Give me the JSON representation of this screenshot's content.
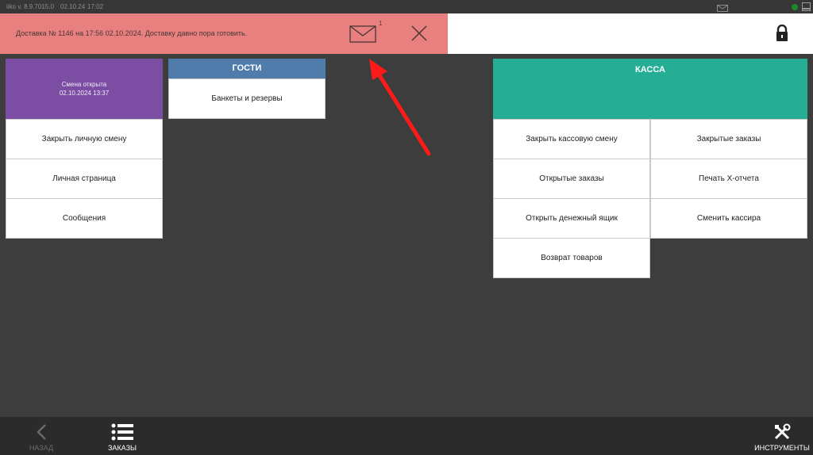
{
  "status_bar": {
    "version": "iiko  v. 8.9.7015.0",
    "date": "02.10.24",
    "time": "17:02"
  },
  "notification": {
    "text": "Доставка № 1146 на 17:56 02.10.2024. Доставку давно пора готовить.",
    "unread_count": "1"
  },
  "shift": {
    "status": "Смена открыта",
    "datetime": "02.10.2024 13:37"
  },
  "personal_menu": {
    "close_shift": "Закрыть личную смену",
    "personal_page": "Личная страница",
    "messages": "Сообщения"
  },
  "guests": {
    "header": "ГОСТИ",
    "banquets": "Банкеты и резервы"
  },
  "kassa": {
    "header": "КАССА",
    "close_cash_shift": "Закрыть кассовую смену",
    "closed_orders": "Закрытые заказы",
    "open_orders": "Открытые заказы",
    "x_report": "Печать Х-отчета",
    "open_cash_drawer": "Открыть денежный ящик",
    "change_cashier": "Сменить кассира",
    "return_goods": "Возврат товаров"
  },
  "bottom_bar": {
    "back": "НАЗАД",
    "orders": "ЗАКАЗЫ",
    "tools": "ИНСТРУМЕНТЫ"
  },
  "colors": {
    "background": "#3c3d3c",
    "notice": "#e8807f",
    "shift_tile": "#7b4ea3",
    "guests_header": "#4f7cab",
    "kassa_header": "#26ad96",
    "annotation_arrow": "#ff1a1a"
  },
  "icons": [
    "mail-icon",
    "close-icon",
    "lock-icon",
    "back-chevron-icon",
    "list-icon",
    "tools-icon",
    "window-icon"
  ]
}
